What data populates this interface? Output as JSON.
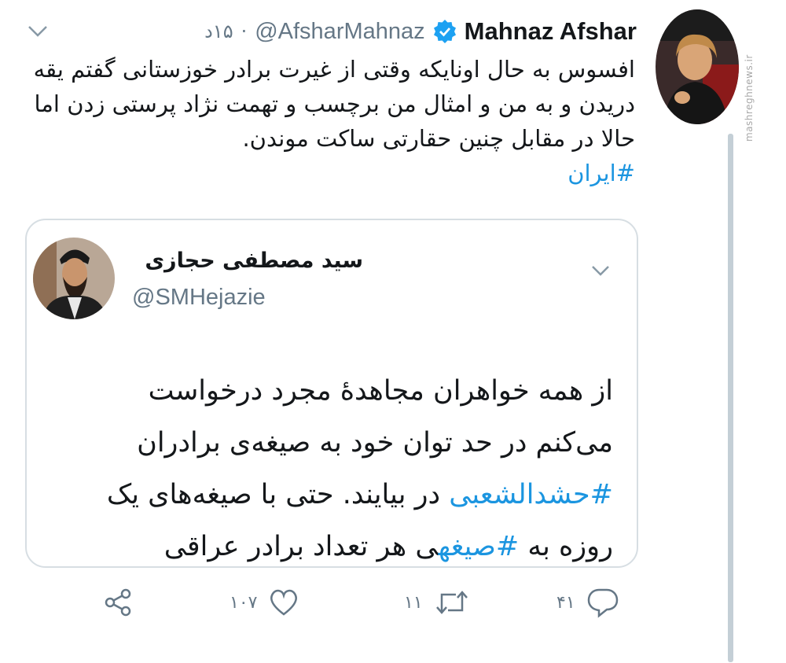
{
  "tweet": {
    "author_name": "Mahnaz Afshar",
    "author_handle": "@AfsharMahnaz",
    "separator": "·",
    "time": "۱۵د",
    "text": "افسوس به حال اونایکه وقتی از غیرت برادر خوزستانی گفتم یقه دریدن و به من و امثال من برچسب و تهمت نژاد پرستی زدن اما حالا در مقابل چنین حقارتی ساکت موندن.",
    "hashtag": "#ایران"
  },
  "quoted": {
    "author_name": "سید مصطفی حجازی",
    "author_handle": "@SMHejazie",
    "text_part1": "از همه خواهران مجاهدهٔ مجرد درخواست می‌کنم در حد توان خود به صیغه‌ی برادران ",
    "hashtag1": "#حشدالشعبی",
    "text_part2": " در بیایند. حتی با صیغه‌های یک روزه به ",
    "hashtag2": "#صیغه",
    "text_part3": "ی هر تعداد برادر عراقی"
  },
  "actions": {
    "reply_count": "۴۱",
    "retweet_count": "۱۱",
    "like_count": "۱۰۷"
  },
  "watermark": "mashreghnews.ir",
  "colors": {
    "link": "#1b95e0",
    "secondary": "#657786",
    "verified": "#1da1f2",
    "border": "#d7dee3",
    "thread_line": "#c4cfd6"
  },
  "icons": [
    "chevron-down-icon",
    "verified-badge-icon",
    "reply-icon",
    "retweet-icon",
    "like-icon",
    "share-icon"
  ]
}
